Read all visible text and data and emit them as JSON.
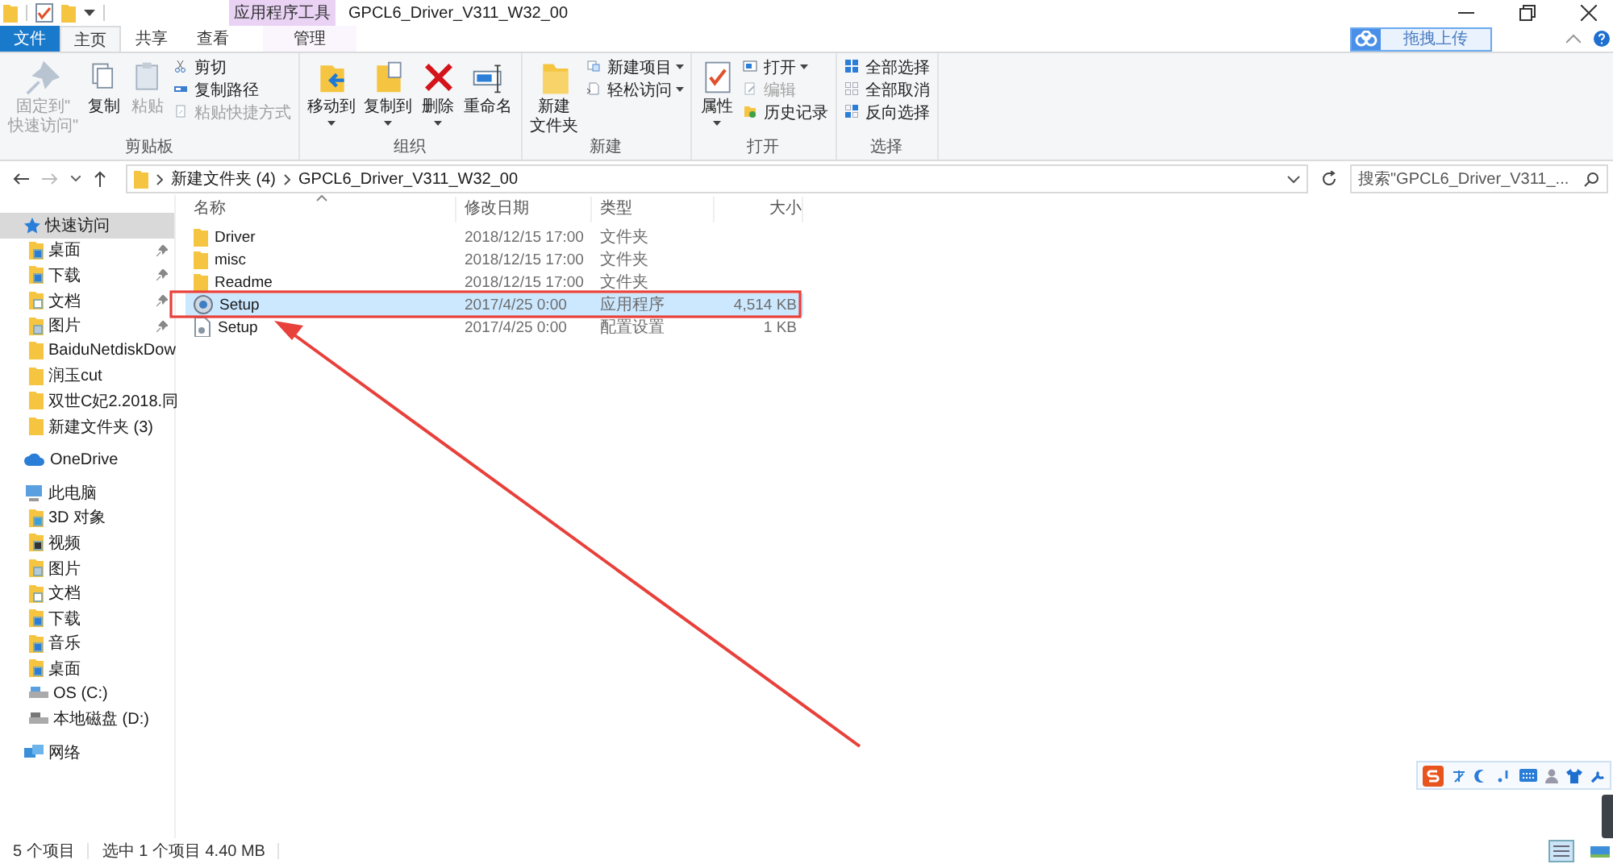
{
  "title_bar": {
    "contextual_header": "应用程序工具",
    "title": "GPCL6_Driver_V311_W32_00"
  },
  "ribbon_tabs": [
    {
      "label": "文件",
      "kind": "file",
      "selected": false
    },
    {
      "label": "主页",
      "kind": "tab",
      "selected": true
    },
    {
      "label": "共享",
      "kind": "tab",
      "selected": false
    },
    {
      "label": "查看",
      "kind": "tab",
      "selected": false
    },
    {
      "label": "管理",
      "kind": "contextual",
      "selected": false
    }
  ],
  "upload_button": "拖拽上传",
  "ribbon_groups": [
    {
      "label": "剪贴板",
      "commands": [
        {
          "kind": "large",
          "lines": [
            "固定到\"",
            "快速访问\""
          ],
          "disabled": true,
          "dropdown": false
        },
        {
          "kind": "large",
          "lines": [
            "复制"
          ],
          "disabled": false,
          "dropdown": false
        },
        {
          "kind": "large",
          "lines": [
            "粘贴"
          ],
          "disabled": true,
          "dropdown": false
        },
        {
          "kind": "small",
          "lines": [
            "剪切"
          ],
          "disabled": false,
          "dropdown": false
        },
        {
          "kind": "small",
          "lines": [
            "复制路径"
          ],
          "disabled": false,
          "dropdown": false
        },
        {
          "kind": "small",
          "lines": [
            "粘贴快捷方式"
          ],
          "disabled": true,
          "dropdown": false
        }
      ]
    },
    {
      "label": "组织",
      "commands": [
        {
          "kind": "large",
          "lines": [
            "移动到"
          ],
          "disabled": false,
          "dropdown": true
        },
        {
          "kind": "large",
          "lines": [
            "复制到"
          ],
          "disabled": false,
          "dropdown": true
        },
        {
          "kind": "large",
          "lines": [
            "删除"
          ],
          "disabled": false,
          "dropdown": true
        },
        {
          "kind": "large",
          "lines": [
            "重命名"
          ],
          "disabled": false,
          "dropdown": false
        }
      ]
    },
    {
      "label": "新建",
      "commands": [
        {
          "kind": "large",
          "lines": [
            "新建",
            "文件夹"
          ],
          "disabled": false,
          "dropdown": false
        },
        {
          "kind": "small",
          "lines": [
            "新建项目"
          ],
          "disabled": false,
          "dropdown": true
        },
        {
          "kind": "small",
          "lines": [
            "轻松访问"
          ],
          "disabled": false,
          "dropdown": true
        }
      ]
    },
    {
      "label": "打开",
      "commands": [
        {
          "kind": "large",
          "lines": [
            "属性"
          ],
          "disabled": false,
          "dropdown": true
        },
        {
          "kind": "small",
          "lines": [
            "打开"
          ],
          "disabled": false,
          "dropdown": true
        },
        {
          "kind": "small",
          "lines": [
            "编辑"
          ],
          "disabled": true,
          "dropdown": false
        },
        {
          "kind": "small",
          "lines": [
            "历史记录"
          ],
          "disabled": false,
          "dropdown": false
        }
      ]
    },
    {
      "label": "选择",
      "commands": [
        {
          "kind": "small",
          "lines": [
            "全部选择"
          ],
          "disabled": false,
          "dropdown": false
        },
        {
          "kind": "small",
          "lines": [
            "全部取消"
          ],
          "disabled": false,
          "dropdown": false
        },
        {
          "kind": "small",
          "lines": [
            "反向选择"
          ],
          "disabled": false,
          "dropdown": false
        }
      ]
    }
  ],
  "address_bar": {
    "breadcrumbs": [
      "新建文件夹 (4)",
      "GPCL6_Driver_V311_W32_00"
    ]
  },
  "search": {
    "placeholder": "搜索\"GPCL6_Driver_V311_..."
  },
  "navigation": [
    {
      "label": "快速访问",
      "kind": "star",
      "selected": true,
      "children": [
        {
          "label": "桌面",
          "kind": "desktop",
          "pinned": true
        },
        {
          "label": "下载",
          "kind": "download",
          "pinned": true
        },
        {
          "label": "文档",
          "kind": "document",
          "pinned": true
        },
        {
          "label": "图片",
          "kind": "pictures",
          "pinned": true
        },
        {
          "label": "BaiduNetdiskDow",
          "kind": "folder",
          "pinned": false
        },
        {
          "label": "润玉cut",
          "kind": "folder",
          "pinned": false
        },
        {
          "label": "双世C妃2.2018.同",
          "kind": "folder",
          "pinned": false
        },
        {
          "label": "新建文件夹 (3)",
          "kind": "folder",
          "pinned": false
        }
      ]
    },
    {
      "label": "OneDrive",
      "kind": "cloud",
      "selected": false
    },
    {
      "label": "此电脑",
      "kind": "computer",
      "selected": false,
      "children": [
        {
          "label": "3D 对象",
          "kind": "objects"
        },
        {
          "label": "视频",
          "kind": "video"
        },
        {
          "label": "图片",
          "kind": "pictures"
        },
        {
          "label": "文档",
          "kind": "document"
        },
        {
          "label": "下载",
          "kind": "download"
        },
        {
          "label": "音乐",
          "kind": "music"
        },
        {
          "label": "桌面",
          "kind": "desktop"
        },
        {
          "label": "OS (C:)",
          "kind": "os-drive"
        },
        {
          "label": "本地磁盘 (D:)",
          "kind": "drive"
        }
      ]
    },
    {
      "label": "网络",
      "kind": "network",
      "selected": false
    }
  ],
  "file_list": {
    "columns": [
      "名称",
      "修改日期",
      "类型",
      "大小"
    ],
    "rows": [
      {
        "name": "Driver",
        "modified": "2018/12/15 17:00",
        "type": "文件夹",
        "kind": "folder",
        "selected": false
      },
      {
        "name": "misc",
        "modified": "2018/12/15 17:00",
        "type": "文件夹",
        "kind": "folder",
        "selected": false
      },
      {
        "name": "Readme",
        "modified": "2018/12/15 17:00",
        "type": "文件夹",
        "kind": "folder",
        "selected": false
      },
      {
        "name": "Setup",
        "modified": "2017/4/25 0:00",
        "type": "应用程序",
        "size": "4,514 KB",
        "kind": "application",
        "selected": true
      },
      {
        "name": "Setup",
        "modified": "2017/4/25 0:00",
        "type": "配置设置",
        "size": "1 KB",
        "kind": "config",
        "selected": false
      }
    ]
  },
  "status_bar": {
    "item_count": "5 个项目",
    "selection": "选中 1 个项目  4.40 MB"
  }
}
